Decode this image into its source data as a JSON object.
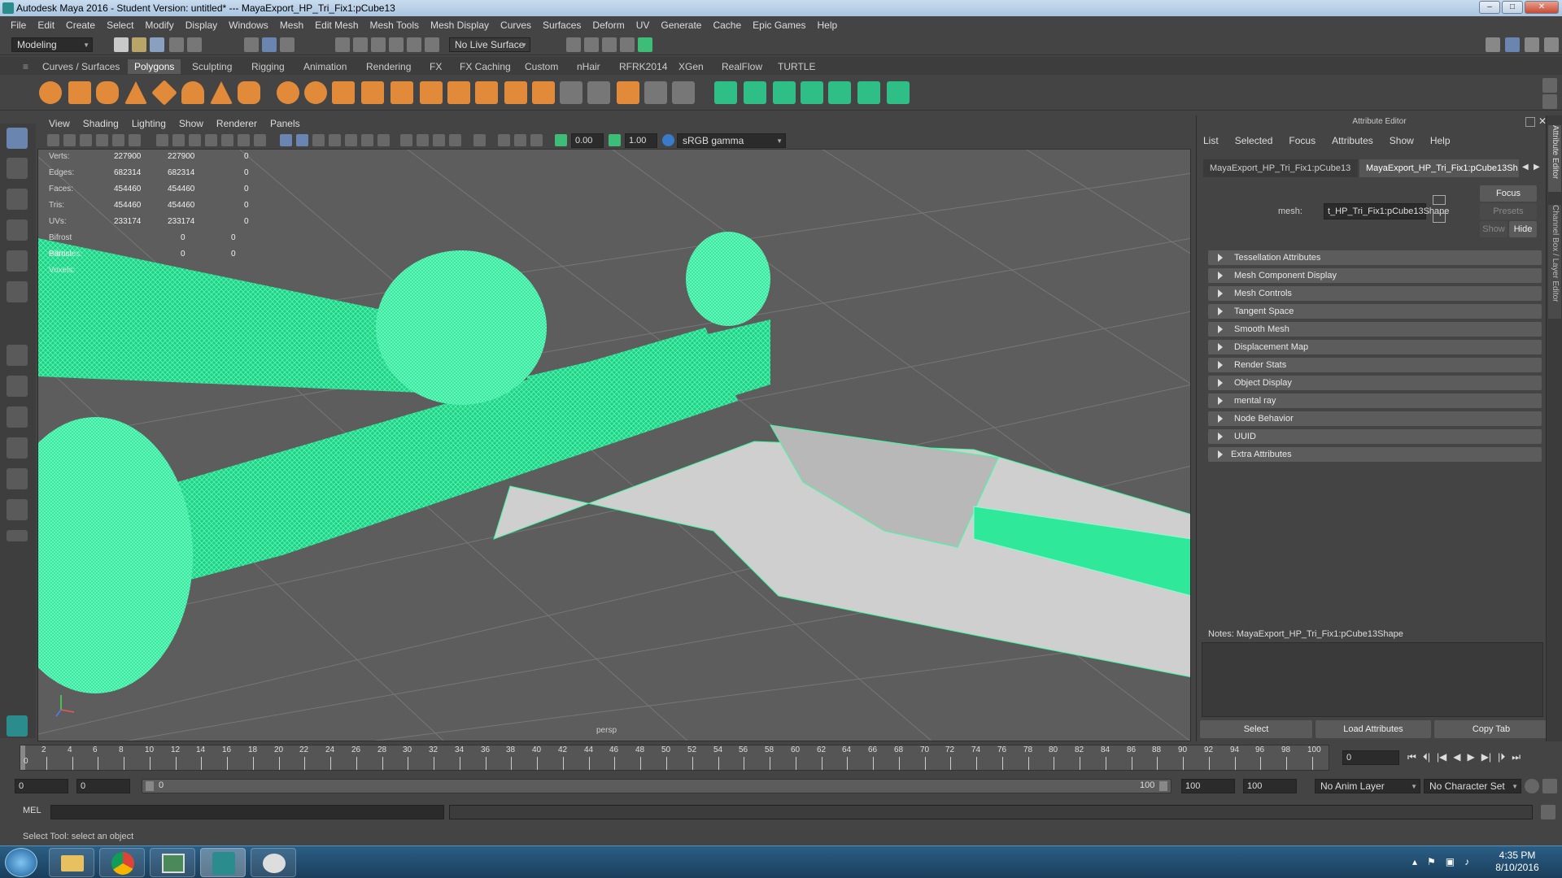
{
  "window": {
    "title": "Autodesk Maya 2016 - Student Version: untitled*   ---   MayaExport_HP_Tri_Fix1:pCube13",
    "minimize": "–",
    "maximize": "□",
    "close": "✕"
  },
  "menubar": [
    "File",
    "Edit",
    "Create",
    "Select",
    "Modify",
    "Display",
    "Windows",
    "Mesh",
    "Edit Mesh",
    "Mesh Tools",
    "Mesh Display",
    "Curves",
    "Surfaces",
    "Deform",
    "UV",
    "Generate",
    "Cache",
    "Epic Games",
    "Help"
  ],
  "statusline": {
    "mode": "Modeling",
    "live_surface": "No Live Surface"
  },
  "shelf_tabs": [
    "Curves / Surfaces",
    "Polygons",
    "Sculpting",
    "Rigging",
    "Animation",
    "Rendering",
    "FX",
    "FX Caching",
    "Custom",
    "nHair",
    "RFRK2014",
    "XGen",
    "RealFlow",
    "TURTLE"
  ],
  "shelf_active": "Polygons",
  "panel_menu": [
    "View",
    "Shading",
    "Lighting",
    "Show",
    "Renderer",
    "Panels"
  ],
  "panel_toolbar": {
    "exposure": "0.00",
    "gamma": "1.00",
    "color_space": "sRGB gamma"
  },
  "hud": [
    {
      "label": "Verts:",
      "a": "227900",
      "b": "227900",
      "c": "0"
    },
    {
      "label": "Edges:",
      "a": "682314",
      "b": "682314",
      "c": "0"
    },
    {
      "label": "Faces:",
      "a": "454460",
      "b": "454460",
      "c": "0"
    },
    {
      "label": "Tris:",
      "a": "454460",
      "b": "454460",
      "c": "0"
    },
    {
      "label": "UVs:",
      "a": "233174",
      "b": "233174",
      "c": "0"
    },
    {
      "label": "Bifrost Particles:",
      "a": "0",
      "b": "0",
      "c": ""
    },
    {
      "label": "Bifrost Voxels:",
      "a": "0",
      "b": "0",
      "c": ""
    }
  ],
  "viewport": {
    "camera_label": "persp",
    "wire_color": "#3dfca0"
  },
  "attribute_editor": {
    "header": "Attribute Editor",
    "menu": [
      "List",
      "Selected",
      "Focus",
      "Attributes",
      "Show",
      "Help"
    ],
    "tabs": [
      "MayaExport_HP_Tri_Fix1:pCube13",
      "MayaExport_HP_Tri_Fix1:pCube13Sh"
    ],
    "mesh_label": "mesh:",
    "mesh_value": "t_HP_Tri_Fix1:pCube13Shape",
    "focus_btn": "Focus",
    "presets_btn": "Presets",
    "show_btn": "Show",
    "hide_btn": "Hide",
    "sections": [
      "Tessellation Attributes",
      "Mesh Component Display",
      "Mesh Controls",
      "Tangent Space",
      "Smooth Mesh",
      "Displacement Map",
      "Render Stats",
      "Object Display",
      "mental ray",
      "Node Behavior",
      "UUID",
      "Extra Attributes"
    ],
    "notes_label": "Notes:  MayaExport_HP_Tri_Fix1:pCube13Shape",
    "buttons": [
      "Select",
      "Load Attributes",
      "Copy Tab"
    ]
  },
  "side_strip": {
    "label1": "Attribute Editor",
    "label2": "Channel Box / Layer Editor"
  },
  "timeline": {
    "ticks": [
      "2",
      "4",
      "6",
      "8",
      "10",
      "12",
      "14",
      "16",
      "18",
      "20",
      "22",
      "24",
      "26",
      "28",
      "30",
      "32",
      "34",
      "36",
      "38",
      "40",
      "42",
      "44",
      "46",
      "48",
      "50",
      "52",
      "54",
      "56",
      "58",
      "60",
      "62",
      "64",
      "66",
      "68",
      "70",
      "72",
      "74",
      "76",
      "78",
      "80",
      "82",
      "84",
      "86",
      "88",
      "90",
      "92",
      "94",
      "96",
      "98",
      "100"
    ],
    "start": "0",
    "current_frame": "0"
  },
  "range": {
    "start": "0",
    "anim_start": "0",
    "slider_start": "0",
    "slider_end": "100",
    "anim_end": "100",
    "end": "100",
    "anim_layer": "No Anim Layer",
    "character_set": "No Character Set"
  },
  "cmdline": {
    "label": "MEL"
  },
  "helpline": "Select Tool: select an object",
  "taskbar": {
    "time": "4:35 PM",
    "date": "8/10/2016"
  }
}
